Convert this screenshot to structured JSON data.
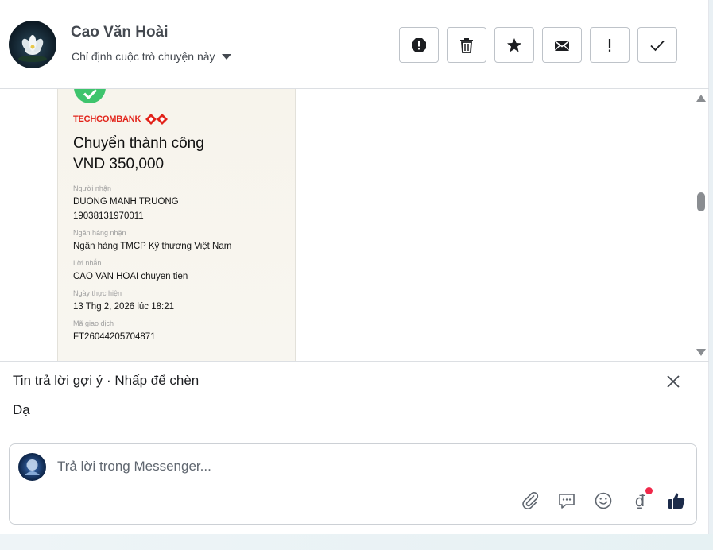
{
  "header": {
    "contact_name": "Cao Văn Hoài",
    "assign_label": "Chỉ định cuộc trò chuyện này",
    "actions": [
      {
        "icon": "spam-octagon-icon",
        "name": "mark-spam-button"
      },
      {
        "icon": "trash-icon",
        "name": "delete-button"
      },
      {
        "icon": "star-icon",
        "name": "star-button"
      },
      {
        "icon": "envelope-icon",
        "name": "mark-unread-button"
      },
      {
        "icon": "exclamation-icon",
        "name": "follow-up-button"
      },
      {
        "icon": "checkmark-icon",
        "name": "mark-done-button"
      }
    ]
  },
  "receipt": {
    "bank_name": "TECHCOMBANK",
    "title": "Chuyển thành công",
    "amount": "VND 350,000",
    "recipient_label": "Người nhận",
    "recipient_name": "DUONG MANH TRUONG",
    "recipient_account": "19038131970011",
    "bank_label": "Ngân hàng nhận",
    "bank_value": "Ngân hàng TMCP Kỹ thương Việt Nam",
    "message_label": "Lời nhắn",
    "message_value": "CAO VAN HOAI chuyen tien",
    "date_label": "Ngày thực hiện",
    "date_value": "13 Thg 2, 2026 lúc 18:21",
    "txid_label": "Mã giao dịch",
    "txid_value": "FT26044205704871"
  },
  "suggestion": {
    "title": "Tin trả lời gợi ý · Nhấp để chèn",
    "items": [
      "Dạ"
    ]
  },
  "composer": {
    "placeholder": "Trả lời trong Messenger...",
    "currency_symbol": "₫",
    "icons": [
      "paperclip-icon",
      "saved-reply-icon",
      "emoji-icon",
      "payment-icon",
      "thumbs-up-icon"
    ]
  },
  "colors": {
    "bank_red": "#e2231a",
    "success_green": "#3ec46d",
    "notification_dot": "#f0284a"
  }
}
